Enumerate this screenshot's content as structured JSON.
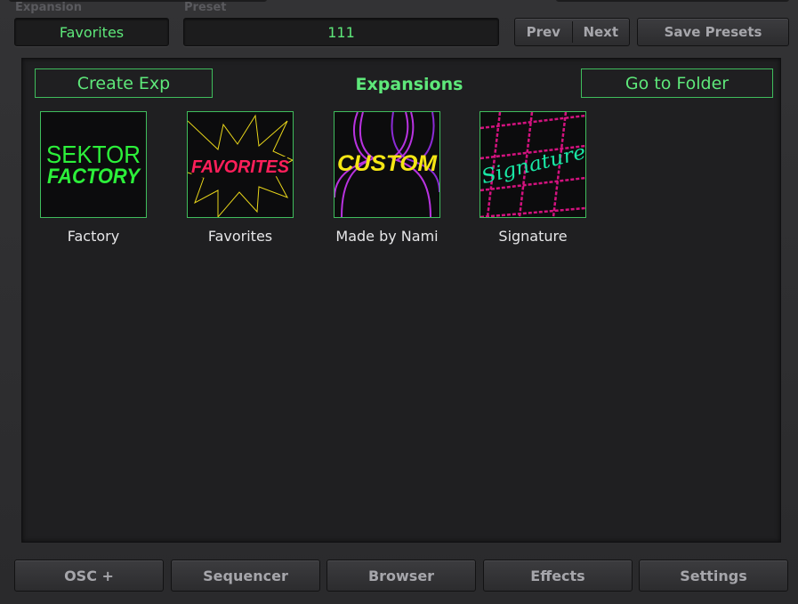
{
  "header": {
    "expansion_label": "Expansion",
    "expansion_value": "Favorites",
    "preset_label": "Preset",
    "preset_value": "111",
    "prev_label": "Prev",
    "next_label": "Next",
    "save_label": "Save Presets"
  },
  "panel": {
    "title": "Expansions",
    "create_label": "Create Exp",
    "folder_label": "Go to Folder",
    "expansions": [
      {
        "name": "Factory",
        "art_line1": "SEKTOR",
        "art_line2": "FACTORY",
        "icon": "sektor-factory-logo"
      },
      {
        "name": "Favorites",
        "art_text": "FAVORITES",
        "icon": "favorites-starburst-art"
      },
      {
        "name": "Made by Nami",
        "art_text": "CUSTOM",
        "icon": "custom-silhouette-art"
      },
      {
        "name": "Signature",
        "art_text": "Signature",
        "icon": "signature-grid-art"
      }
    ]
  },
  "footer": {
    "tabs": [
      {
        "label": "OSC +"
      },
      {
        "label": "Sequencer"
      },
      {
        "label": "Browser"
      },
      {
        "label": "Effects"
      },
      {
        "label": "Settings"
      }
    ]
  },
  "colors": {
    "accent_green": "#5ee87a",
    "tile_border": "#3fbd5c",
    "favorites_pink": "#ff1f5a",
    "custom_yellow": "#f5e614",
    "signature_magenta": "#d4127f",
    "signature_teal": "#19e8a5"
  }
}
